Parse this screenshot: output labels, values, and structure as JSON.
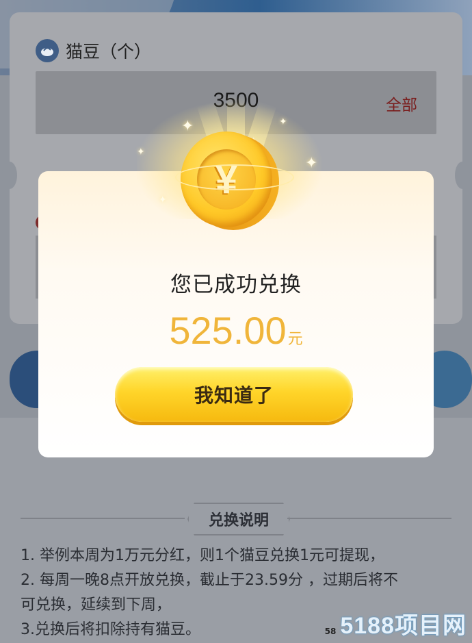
{
  "background_page": {
    "bean_label": "猫豆（个）",
    "amount_value": "3500",
    "all_button": "全部",
    "rules_title": "兑换说明",
    "rules": [
      "1. 举例本周为1万元分红，则1个猫豆兑换1元可提现，",
      "2. 每周一晚8点开放兑换，截止于23.59分 ，过期后将不",
      "可兑换，延续到下周，",
      "3.兑换后将扣除持有猫豆。"
    ]
  },
  "modal": {
    "coin_symbol": "¥",
    "success_text": "您已成功兑换",
    "amount": "525.00",
    "unit": "元",
    "confirm_button": "我知道了"
  },
  "watermark": {
    "small_text": "58",
    "brand_text": "5188项目网"
  },
  "icons": {
    "bean_icon": "bean-icon",
    "coin_icon": "yuan-coin-icon",
    "sparkles": "sparkle-icon"
  },
  "colors": {
    "overlay_dim": "#8f949c",
    "amount_gold": "#f0b53a",
    "button_yellow": "#ffd52a",
    "all_button_red": "#7a1e1e"
  }
}
